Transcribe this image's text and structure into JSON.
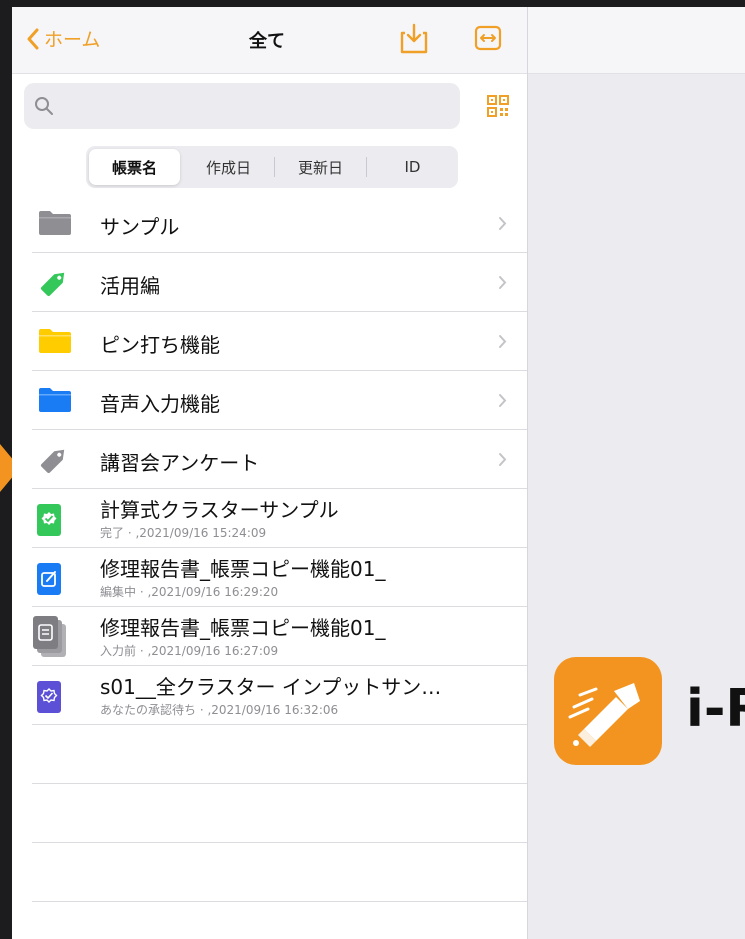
{
  "nav": {
    "back_label": "ホーム",
    "title": "全て"
  },
  "search": {
    "placeholder": ""
  },
  "segments": [
    "帳票名",
    "作成日",
    "更新日",
    "ID"
  ],
  "folders": [
    {
      "label": "サンプル",
      "icon": "gray-folder-icon"
    },
    {
      "label": "活用編",
      "icon": "green-tag-icon"
    },
    {
      "label": "ピン打ち機能",
      "icon": "yellow-folder-icon"
    },
    {
      "label": "音声入力機能",
      "icon": "blue-folder-icon"
    },
    {
      "label": "講習会アンケート",
      "icon": "gray-tag-icon"
    }
  ],
  "forms": [
    {
      "title": "計算式クラスターサンプル",
      "sub": "完了 · ,2021/09/16 15:24:09",
      "icon": "completed-check-icon"
    },
    {
      "title": "修理報告書_帳票コピー機能01_",
      "sub": "編集中 · ,2021/09/16 16:29:20",
      "icon": "editing-icon"
    },
    {
      "title": "修理報告書_帳票コピー機能01_",
      "sub": "入力前 · ,2021/09/16 16:27:09",
      "icon": "before-input-stack-icon"
    },
    {
      "title": "s01__全クラスター インプットサン…",
      "sub": "あなたの承認待ち · ,2021/09/16 16:32:06",
      "icon": "approval-pending-icon"
    }
  ],
  "detail": {
    "app_name": "i-R"
  },
  "colors": {
    "accent": "#f0a027",
    "green": "#34c759",
    "blue": "#1a7cf4",
    "purple": "#5b50d6",
    "gray": "#8e8e93"
  }
}
